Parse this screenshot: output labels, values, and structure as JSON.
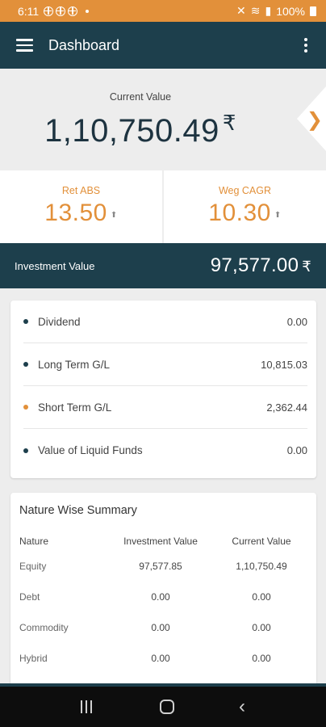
{
  "status_bar": {
    "time": "6:11",
    "battery": "100%"
  },
  "app_bar": {
    "title": "Dashboard"
  },
  "hero": {
    "label": "Current Value",
    "value": "1,10,750.49",
    "currency": "₹"
  },
  "returns": {
    "abs_label": "Ret ABS",
    "abs_value": "13.50",
    "cagr_label": "Weg CAGR",
    "cagr_value": "10.30",
    "trend_icon": "arrow-up-icon"
  },
  "investment": {
    "label": "Investment Value",
    "value": "97,577.00",
    "currency": "₹"
  },
  "gains": [
    {
      "label": "Dividend",
      "value": "0.00",
      "dot": "#1d3f4c"
    },
    {
      "label": "Long Term G/L",
      "value": "10,815.03",
      "dot": "#1d3f4c"
    },
    {
      "label": "Short Term G/L",
      "value": "2,362.44",
      "dot": "#e2903a"
    },
    {
      "label": "Value of Liquid Funds",
      "value": "0.00",
      "dot": "#1d3f4c"
    }
  ],
  "nature_summary": {
    "title": "Nature Wise Summary",
    "columns": [
      "Nature",
      "Investment Value",
      "Current Value"
    ],
    "rows": [
      {
        "nature": "Equity",
        "investment": "97,577.85",
        "current": "1,10,750.49"
      },
      {
        "nature": "Debt",
        "investment": "0.00",
        "current": "0.00"
      },
      {
        "nature": "Commodity",
        "investment": "0.00",
        "current": "0.00"
      },
      {
        "nature": "Hybrid",
        "investment": "0.00",
        "current": "0.00"
      }
    ]
  },
  "colors": {
    "primary": "#1d3f4c",
    "accent": "#e2903a"
  }
}
